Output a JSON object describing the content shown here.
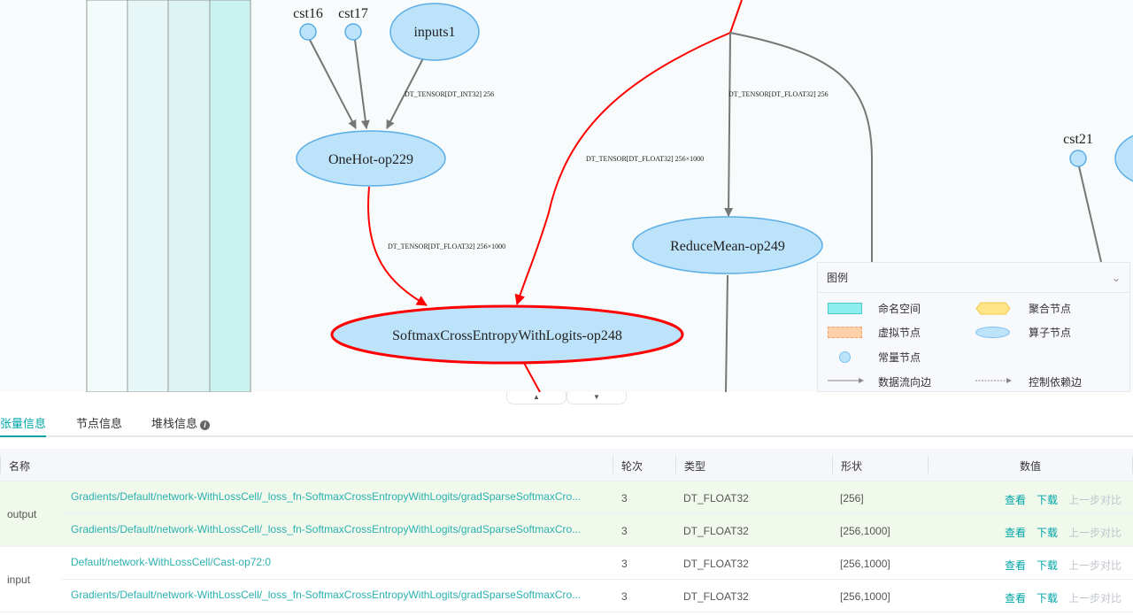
{
  "graph": {
    "nodes": {
      "cst16": "cst16",
      "cst17": "cst17",
      "inputs1": "inputs1",
      "onehot": "OneHot-op229",
      "softmax": "SoftmaxCrossEntropyWithLogits-op248",
      "reducemean": "ReduceMean-op249",
      "cst21": "cst21"
    },
    "edges": {
      "int32": "DT_TENSOR[DT_INT32] 256",
      "onehot_out": "DT_TENSOR[DT_FLOAT32] 256×1000",
      "logits_in": "DT_TENSOR[DT_FLOAT32] 256×1000",
      "reduce_in": "DT_TENSOR[DT_FLOAT32] 256"
    },
    "colors": {
      "selected_edge": "#ff0000",
      "op_node": "#bde3fb",
      "op_stroke": "#5aaee6",
      "selected_stroke": "#ff0000"
    }
  },
  "legend": {
    "title": "图例",
    "items": {
      "namespace": "命名空间",
      "aggregate": "聚合节点",
      "virtual": "虚拟节点",
      "operator": "算子节点",
      "const": "常量节点",
      "dataflow": "数据流向边",
      "control": "控制依赖边"
    }
  },
  "toggles": {
    "up": "▲",
    "down": "▼"
  },
  "tabs": [
    {
      "label": "张量信息",
      "active": true
    },
    {
      "label": "节点信息",
      "active": false
    },
    {
      "label": "堆栈信息",
      "active": false
    }
  ],
  "table": {
    "headers": {
      "name": "名称",
      "step": "轮次",
      "type": "类型",
      "shape": "形状",
      "value": "数值"
    },
    "actions": {
      "view": "查看",
      "download": "下载",
      "compare": "上一步对比"
    },
    "groups": [
      {
        "label": "output",
        "rows": [
          {
            "name": "Gradients/Default/network-WithLossCell/_loss_fn-SoftmaxCrossEntropyWithLogits/gradSparseSoftmaxCro...",
            "step": "3",
            "type": "DT_FLOAT32",
            "shape": "[256]"
          },
          {
            "name": "Gradients/Default/network-WithLossCell/_loss_fn-SoftmaxCrossEntropyWithLogits/gradSparseSoftmaxCro...",
            "step": "3",
            "type": "DT_FLOAT32",
            "shape": "[256,1000]"
          }
        ]
      },
      {
        "label": "input",
        "rows": [
          {
            "name": "Default/network-WithLossCell/Cast-op72:0",
            "step": "3",
            "type": "DT_FLOAT32",
            "shape": "[256,1000]"
          },
          {
            "name": "Gradients/Default/network-WithLossCell/_loss_fn-SoftmaxCrossEntropyWithLogits/gradSparseSoftmaxCro...",
            "step": "3",
            "type": "DT_FLOAT32",
            "shape": "[256,1000]"
          }
        ]
      }
    ]
  }
}
